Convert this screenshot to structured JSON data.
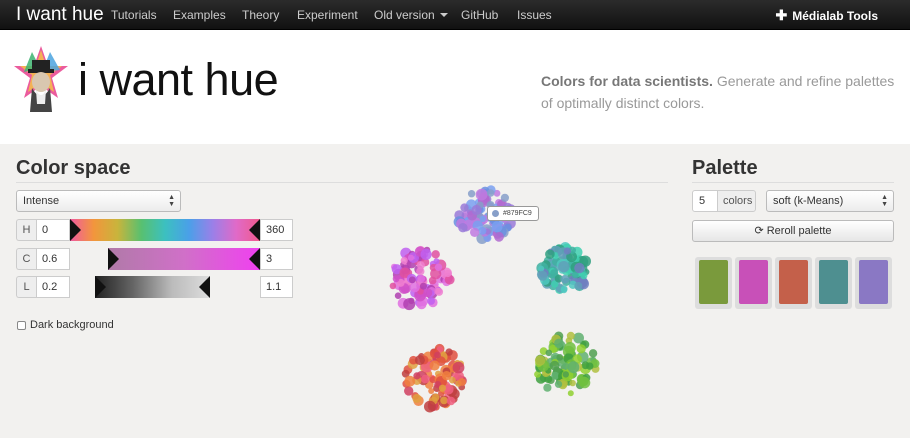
{
  "navbar": {
    "brand": "I want hue",
    "items": [
      "Tutorials",
      "Examples",
      "Theory",
      "Experiment",
      "Old version",
      "GitHub",
      "Issues"
    ],
    "tools": "Médialab Tools"
  },
  "header": {
    "title": "i want hue",
    "tagline_bold": "Colors for data scientists.",
    "tagline_rest": " Generate and refine palettes of optimally distinct colors."
  },
  "color_space": {
    "title": "Color space",
    "preset": "Intense",
    "sliders": [
      {
        "label": "H",
        "min": "0",
        "max": "360"
      },
      {
        "label": "C",
        "min": "0.6",
        "max": "3"
      },
      {
        "label": "L",
        "min": "0.2",
        "max": "1.1"
      }
    ],
    "dark_background_label": "Dark background",
    "dark_background_checked": false
  },
  "palette": {
    "title": "Palette",
    "count": "5",
    "count_unit": "colors",
    "method": "soft (k-Means)",
    "reroll_label": "Reroll palette",
    "swatches": [
      "#7a9a3c",
      "#c850b8",
      "#c4604a",
      "#4e8f90",
      "#8a78c4"
    ]
  },
  "tooltip": {
    "hex": "#879FC9"
  },
  "clouds": [
    {
      "name": "blue-purple",
      "colors": [
        "#879FC9",
        "#9a7ad8",
        "#6a8fe0",
        "#c07ae0",
        "#7aa0f0",
        "#b06ad0"
      ]
    },
    {
      "name": "magenta",
      "colors": [
        "#d050c8",
        "#e070e0",
        "#b040b0",
        "#f080d0",
        "#c060f0",
        "#e050a0"
      ]
    },
    {
      "name": "teal",
      "colors": [
        "#40b0a0",
        "#50c8c0",
        "#60a0b8",
        "#40d0b0",
        "#7080c0",
        "#30a080"
      ]
    },
    {
      "name": "red-orange",
      "colors": [
        "#e05040",
        "#f08040",
        "#d04060",
        "#e0a040",
        "#c04040",
        "#f06080"
      ]
    },
    {
      "name": "green",
      "colors": [
        "#70c040",
        "#90d030",
        "#50a050",
        "#b0c040",
        "#60b070",
        "#40a040"
      ]
    }
  ]
}
